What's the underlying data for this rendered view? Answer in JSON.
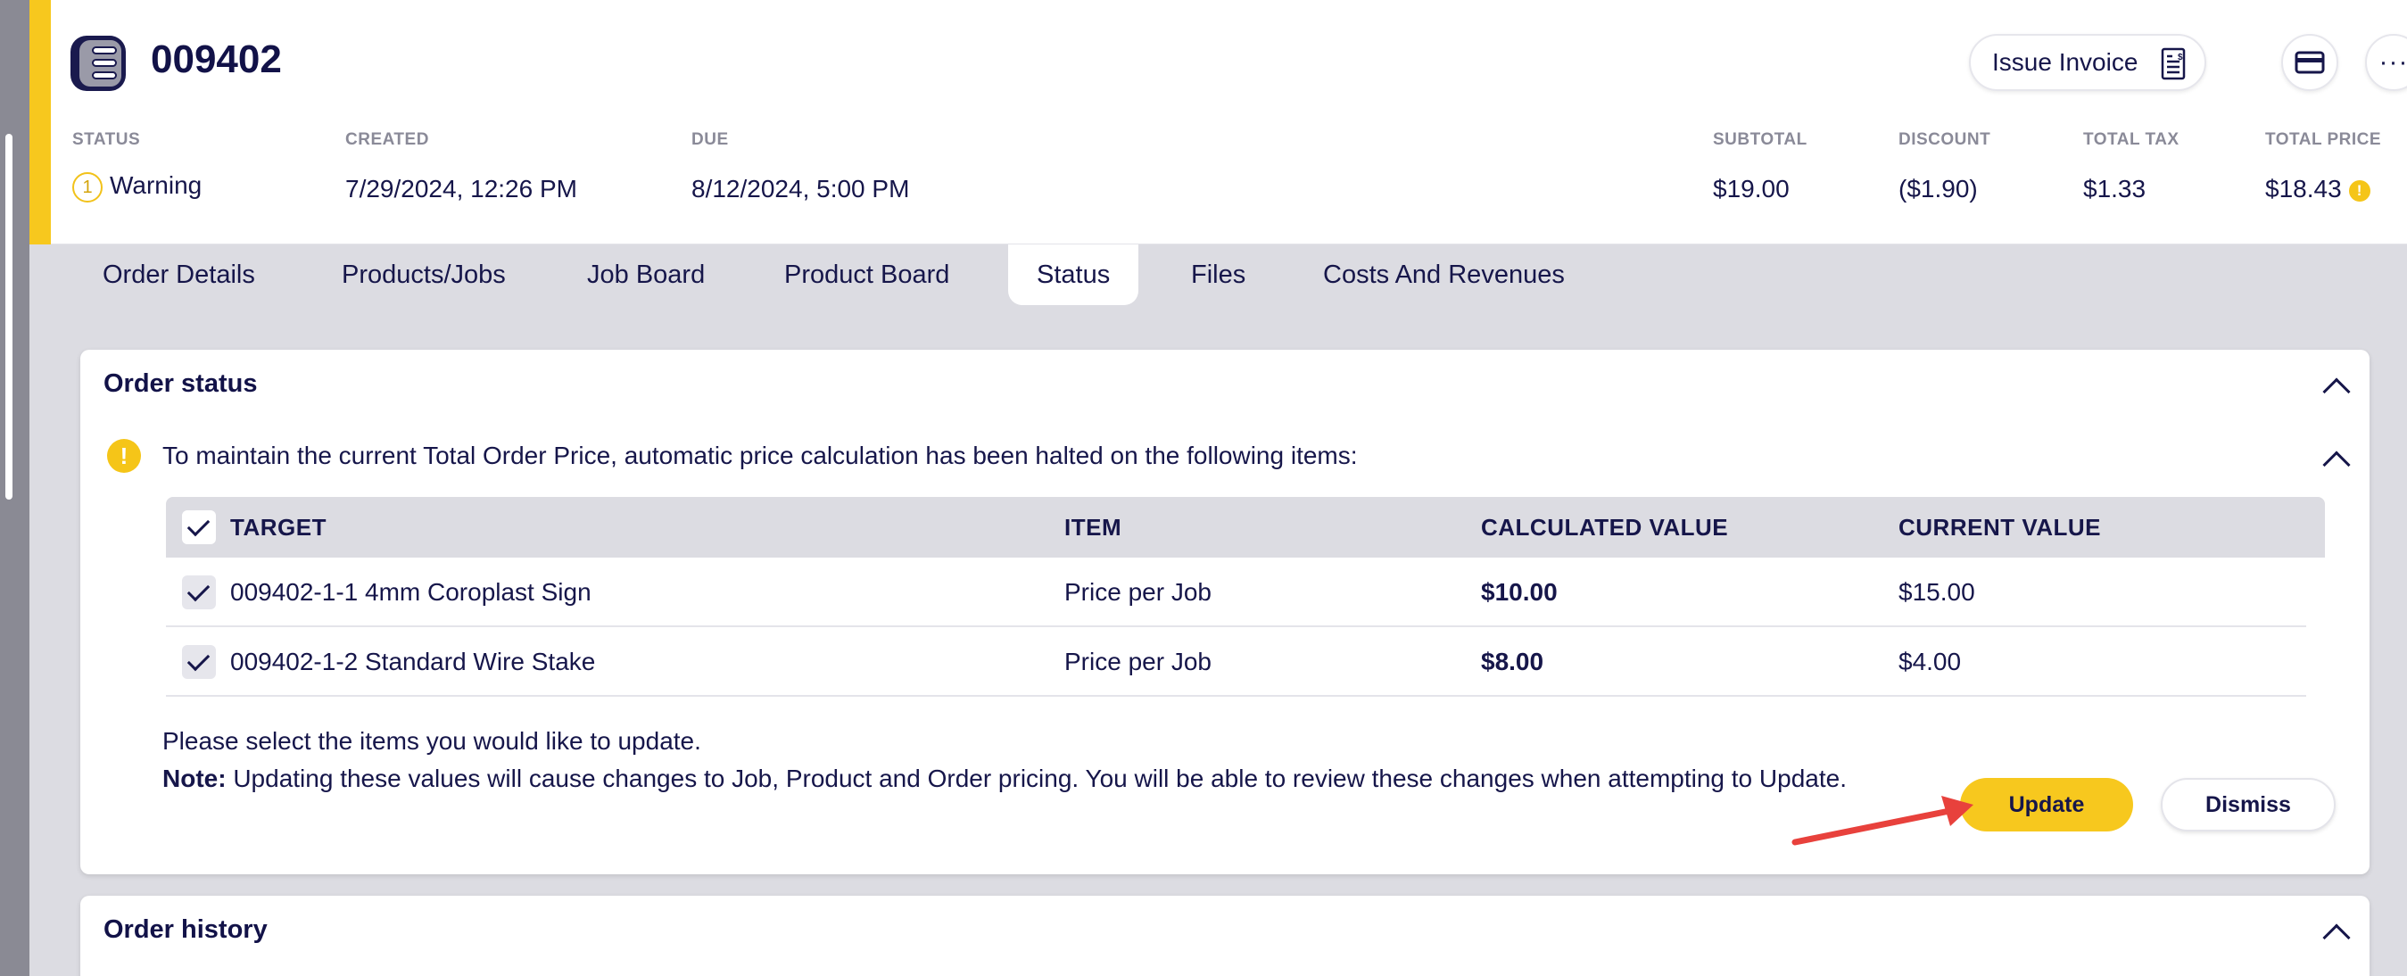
{
  "order": {
    "number": "009402",
    "issue_invoice_label": "Issue Invoice"
  },
  "meta": {
    "status": {
      "label": "STATUS",
      "value": "Warning",
      "count": "1"
    },
    "created": {
      "label": "CREATED",
      "value": "7/29/2024, 12:26 PM"
    },
    "due": {
      "label": "DUE",
      "value": "8/12/2024, 5:00 PM"
    },
    "subtotal": {
      "label": "SUBTOTAL",
      "value": "$19.00"
    },
    "discount": {
      "label": "DISCOUNT",
      "value": "($1.90)"
    },
    "total_tax": {
      "label": "TOTAL TAX",
      "value": "$1.33"
    },
    "total_price": {
      "label": "TOTAL PRICE",
      "value": "$18.43"
    }
  },
  "tabs": [
    {
      "label": "Order Details"
    },
    {
      "label": "Products/Jobs"
    },
    {
      "label": "Job Board"
    },
    {
      "label": "Product Board"
    },
    {
      "label": "Status",
      "active": true
    },
    {
      "label": "Files"
    },
    {
      "label": "Costs And Revenues"
    }
  ],
  "order_status": {
    "title": "Order status",
    "notice": "To maintain the current Total Order Price, automatic price calculation has been halted on the following items:",
    "columns": [
      "TARGET",
      "ITEM",
      "CALCULATED VALUE",
      "CURRENT VALUE"
    ],
    "rows": [
      {
        "target": "009402-1-1 4mm Coroplast Sign",
        "item": "Price per Job",
        "calculated": "$10.00",
        "current": "$15.00"
      },
      {
        "target": "009402-1-2 Standard Wire Stake",
        "item": "Price per Job",
        "calculated": "$8.00",
        "current": "$4.00"
      }
    ],
    "select_text": "Please select the items you would like to update.",
    "note_label": "Note:",
    "note_text": " Updating these values will cause changes to Job, Product and Order pricing. You will be able to review these changes when attempting to Update.",
    "update_label": "Update",
    "dismiss_label": "Dismiss"
  },
  "order_history": {
    "title": "Order history"
  },
  "colors": {
    "accent": "#f7c81e",
    "navy": "#16164a",
    "annotation_arrow": "#e8413c"
  }
}
